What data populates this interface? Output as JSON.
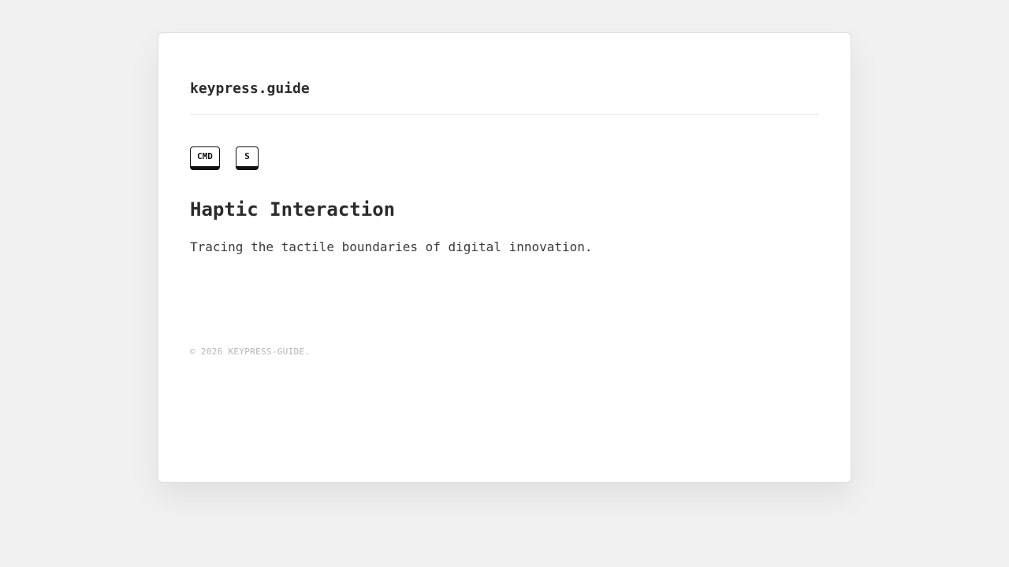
{
  "header": {
    "brand": "keypress.guide"
  },
  "shortcut": {
    "keys": [
      "CMD",
      "S"
    ]
  },
  "content": {
    "title": "Haptic Interaction",
    "tagline": "Tracing the tactile boundaries of digital innovation."
  },
  "footer": {
    "copyright": "© 2026 KEYPRESS-GUIDE."
  },
  "colors": {
    "background": "#f1f1f1",
    "card": "#ffffff",
    "text": "#2b2b2b",
    "muted": "#b5b5b5",
    "key_border": "#111111"
  }
}
